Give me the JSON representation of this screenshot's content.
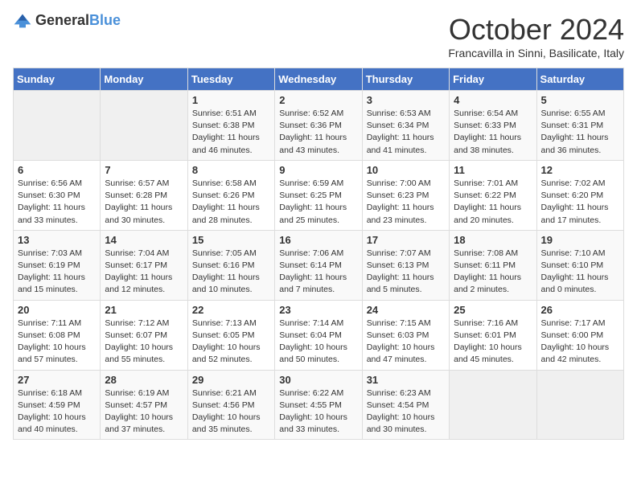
{
  "logo": {
    "general": "General",
    "blue": "Blue"
  },
  "title": "October 2024",
  "subtitle": "Francavilla in Sinni, Basilicate, Italy",
  "days_of_week": [
    "Sunday",
    "Monday",
    "Tuesday",
    "Wednesday",
    "Thursday",
    "Friday",
    "Saturday"
  ],
  "weeks": [
    [
      {
        "day": "",
        "empty": true
      },
      {
        "day": "",
        "empty": true
      },
      {
        "day": "1",
        "sunrise": "6:51 AM",
        "sunset": "6:38 PM",
        "daylight": "11 hours and 46 minutes."
      },
      {
        "day": "2",
        "sunrise": "6:52 AM",
        "sunset": "6:36 PM",
        "daylight": "11 hours and 43 minutes."
      },
      {
        "day": "3",
        "sunrise": "6:53 AM",
        "sunset": "6:34 PM",
        "daylight": "11 hours and 41 minutes."
      },
      {
        "day": "4",
        "sunrise": "6:54 AM",
        "sunset": "6:33 PM",
        "daylight": "11 hours and 38 minutes."
      },
      {
        "day": "5",
        "sunrise": "6:55 AM",
        "sunset": "6:31 PM",
        "daylight": "11 hours and 36 minutes."
      }
    ],
    [
      {
        "day": "6",
        "sunrise": "6:56 AM",
        "sunset": "6:30 PM",
        "daylight": "11 hours and 33 minutes."
      },
      {
        "day": "7",
        "sunrise": "6:57 AM",
        "sunset": "6:28 PM",
        "daylight": "11 hours and 30 minutes."
      },
      {
        "day": "8",
        "sunrise": "6:58 AM",
        "sunset": "6:26 PM",
        "daylight": "11 hours and 28 minutes."
      },
      {
        "day": "9",
        "sunrise": "6:59 AM",
        "sunset": "6:25 PM",
        "daylight": "11 hours and 25 minutes."
      },
      {
        "day": "10",
        "sunrise": "7:00 AM",
        "sunset": "6:23 PM",
        "daylight": "11 hours and 23 minutes."
      },
      {
        "day": "11",
        "sunrise": "7:01 AM",
        "sunset": "6:22 PM",
        "daylight": "11 hours and 20 minutes."
      },
      {
        "day": "12",
        "sunrise": "7:02 AM",
        "sunset": "6:20 PM",
        "daylight": "11 hours and 17 minutes."
      }
    ],
    [
      {
        "day": "13",
        "sunrise": "7:03 AM",
        "sunset": "6:19 PM",
        "daylight": "11 hours and 15 minutes."
      },
      {
        "day": "14",
        "sunrise": "7:04 AM",
        "sunset": "6:17 PM",
        "daylight": "11 hours and 12 minutes."
      },
      {
        "day": "15",
        "sunrise": "7:05 AM",
        "sunset": "6:16 PM",
        "daylight": "11 hours and 10 minutes."
      },
      {
        "day": "16",
        "sunrise": "7:06 AM",
        "sunset": "6:14 PM",
        "daylight": "11 hours and 7 minutes."
      },
      {
        "day": "17",
        "sunrise": "7:07 AM",
        "sunset": "6:13 PM",
        "daylight": "11 hours and 5 minutes."
      },
      {
        "day": "18",
        "sunrise": "7:08 AM",
        "sunset": "6:11 PM",
        "daylight": "11 hours and 2 minutes."
      },
      {
        "day": "19",
        "sunrise": "7:10 AM",
        "sunset": "6:10 PM",
        "daylight": "11 hours and 0 minutes."
      }
    ],
    [
      {
        "day": "20",
        "sunrise": "7:11 AM",
        "sunset": "6:08 PM",
        "daylight": "10 hours and 57 minutes."
      },
      {
        "day": "21",
        "sunrise": "7:12 AM",
        "sunset": "6:07 PM",
        "daylight": "10 hours and 55 minutes."
      },
      {
        "day": "22",
        "sunrise": "7:13 AM",
        "sunset": "6:05 PM",
        "daylight": "10 hours and 52 minutes."
      },
      {
        "day": "23",
        "sunrise": "7:14 AM",
        "sunset": "6:04 PM",
        "daylight": "10 hours and 50 minutes."
      },
      {
        "day": "24",
        "sunrise": "7:15 AM",
        "sunset": "6:03 PM",
        "daylight": "10 hours and 47 minutes."
      },
      {
        "day": "25",
        "sunrise": "7:16 AM",
        "sunset": "6:01 PM",
        "daylight": "10 hours and 45 minutes."
      },
      {
        "day": "26",
        "sunrise": "7:17 AM",
        "sunset": "6:00 PM",
        "daylight": "10 hours and 42 minutes."
      }
    ],
    [
      {
        "day": "27",
        "sunrise": "6:18 AM",
        "sunset": "4:59 PM",
        "daylight": "10 hours and 40 minutes."
      },
      {
        "day": "28",
        "sunrise": "6:19 AM",
        "sunset": "4:57 PM",
        "daylight": "10 hours and 37 minutes."
      },
      {
        "day": "29",
        "sunrise": "6:21 AM",
        "sunset": "4:56 PM",
        "daylight": "10 hours and 35 minutes."
      },
      {
        "day": "30",
        "sunrise": "6:22 AM",
        "sunset": "4:55 PM",
        "daylight": "10 hours and 33 minutes."
      },
      {
        "day": "31",
        "sunrise": "6:23 AM",
        "sunset": "4:54 PM",
        "daylight": "10 hours and 30 minutes."
      },
      {
        "day": "",
        "empty": true
      },
      {
        "day": "",
        "empty": true
      }
    ]
  ]
}
